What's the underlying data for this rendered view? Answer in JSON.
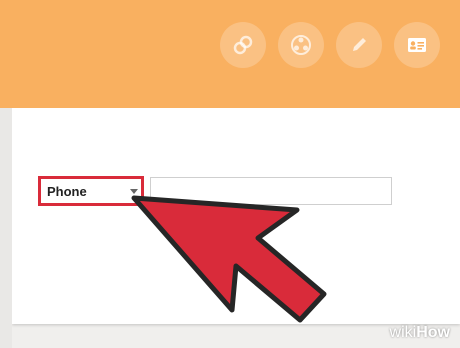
{
  "header": {
    "buttons": [
      {
        "name": "link-icon"
      },
      {
        "name": "circles-icon"
      },
      {
        "name": "pencil-icon"
      },
      {
        "name": "contact-card-icon"
      }
    ]
  },
  "form": {
    "type_label": "Phone",
    "phone_value": "",
    "phone_placeholder": ""
  },
  "watermark": {
    "wiki": "wiki",
    "how": "How"
  },
  "colors": {
    "header": "#f9b060",
    "highlight": "#d92b3a"
  }
}
